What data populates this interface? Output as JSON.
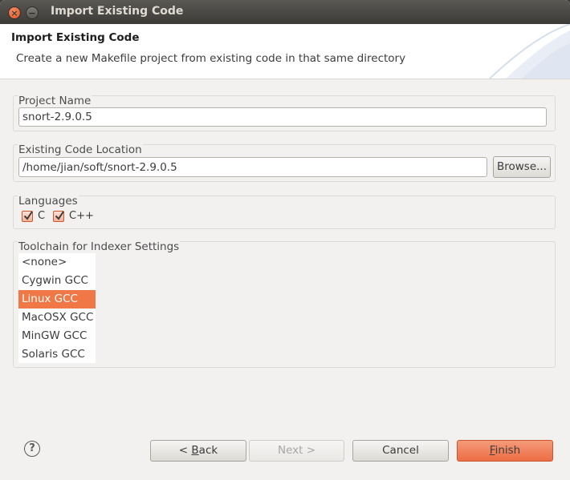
{
  "window": {
    "title": "Import Existing Code",
    "close_glyph": "×",
    "min_glyph": "−"
  },
  "header": {
    "title": "Import Existing Code",
    "description": "Create a new Makefile project from existing code in that same directory"
  },
  "project_name": {
    "label": "Project Name",
    "value": "snort-2.9.0.5"
  },
  "code_location": {
    "label": "Existing Code Location",
    "value": "/home/jian/soft/snort-2.9.0.5",
    "browse_label": "Browse..."
  },
  "languages": {
    "label": "Languages",
    "items": [
      {
        "label": "C",
        "checked": true
      },
      {
        "label": "C++",
        "checked": true
      }
    ]
  },
  "toolchain": {
    "label": "Toolchain for Indexer Settings",
    "items": [
      "<none>",
      "Cygwin GCC",
      "Linux GCC",
      "MacOSX GCC",
      "MinGW GCC",
      "Solaris GCC"
    ],
    "selected": "Linux GCC"
  },
  "footer": {
    "help_glyph": "?",
    "back_prefix": "< ",
    "back_mnemonic": "B",
    "back_rest": "ack",
    "next_label": "Next >",
    "cancel_label": "Cancel",
    "finish_mnemonic": "F",
    "finish_rest": "inish"
  },
  "colors": {
    "accent": "#f07746",
    "titlebar": "#3c3b37"
  }
}
